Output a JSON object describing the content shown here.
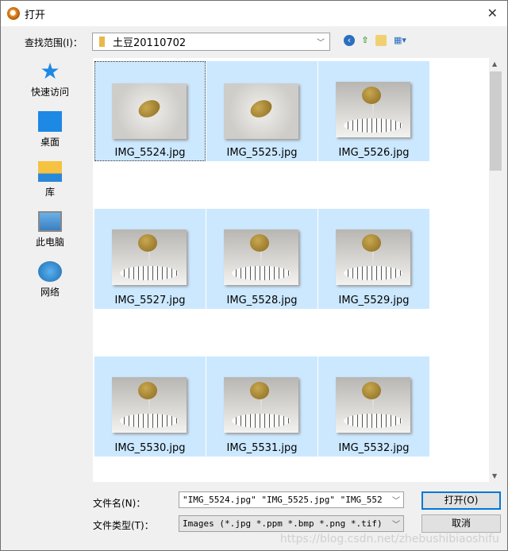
{
  "window": {
    "title": "打开"
  },
  "toolbar": {
    "look_in_label": "查找范围(I)：",
    "look_in_value": "土豆20110702"
  },
  "sidebar": {
    "items": [
      {
        "label": "快速访问"
      },
      {
        "label": "桌面"
      },
      {
        "label": "库"
      },
      {
        "label": "此电脑"
      },
      {
        "label": "网络"
      }
    ]
  },
  "files": [
    {
      "name": "IMG_5524.jpg",
      "style": "top"
    },
    {
      "name": "IMG_5525.jpg",
      "style": "top"
    },
    {
      "name": "IMG_5526.jpg",
      "style": "side"
    },
    {
      "name": "IMG_5527.jpg",
      "style": "side"
    },
    {
      "name": "IMG_5528.jpg",
      "style": "side"
    },
    {
      "name": "IMG_5529.jpg",
      "style": "side"
    },
    {
      "name": "IMG_5530.jpg",
      "style": "side"
    },
    {
      "name": "IMG_5531.jpg",
      "style": "side"
    },
    {
      "name": "IMG_5532.jpg",
      "style": "side"
    }
  ],
  "footer": {
    "filename_label": "文件名(N)：",
    "filename_value": "\"IMG_5524.jpg\" \"IMG_5525.jpg\" \"IMG_552",
    "filetype_label": "文件类型(T)：",
    "filetype_value": "Images (*.jpg *.ppm *.bmp *.png *.tif)",
    "open_label": "打开(O)",
    "cancel_label": "取消"
  },
  "watermark": "https://blog.csdn.net/zhebushibiaoshifu"
}
